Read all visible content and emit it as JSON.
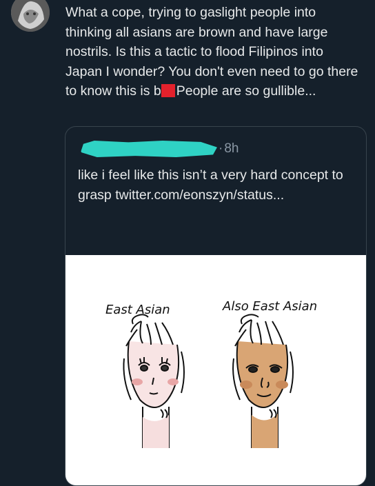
{
  "tweet": {
    "avatar_icon": "user-avatar-icon",
    "text_before_redaction": "What a cope, trying to gaslight people into thinking all asians are brown and have large nostrils. Is this a tactic to flood Filipinos into Japan I wonder? You don't even need to go there to know this is b",
    "text_after_redaction": "People are so gullible..."
  },
  "quoted_tweet": {
    "timestamp": "8h",
    "separator": "·",
    "text": "like i feel like this isn’t a very hard concept to grasp twitter.com/eonszyn/status...",
    "image": {
      "left_label": "East Asian",
      "right_label": "Also East Asian"
    }
  },
  "colors": {
    "background": "#15202b",
    "text": "#e7e9ea",
    "muted": "#8b98a5",
    "card_border": "#38444d",
    "redaction_red": "#e3212c",
    "redaction_teal": "#2fd2c4"
  }
}
